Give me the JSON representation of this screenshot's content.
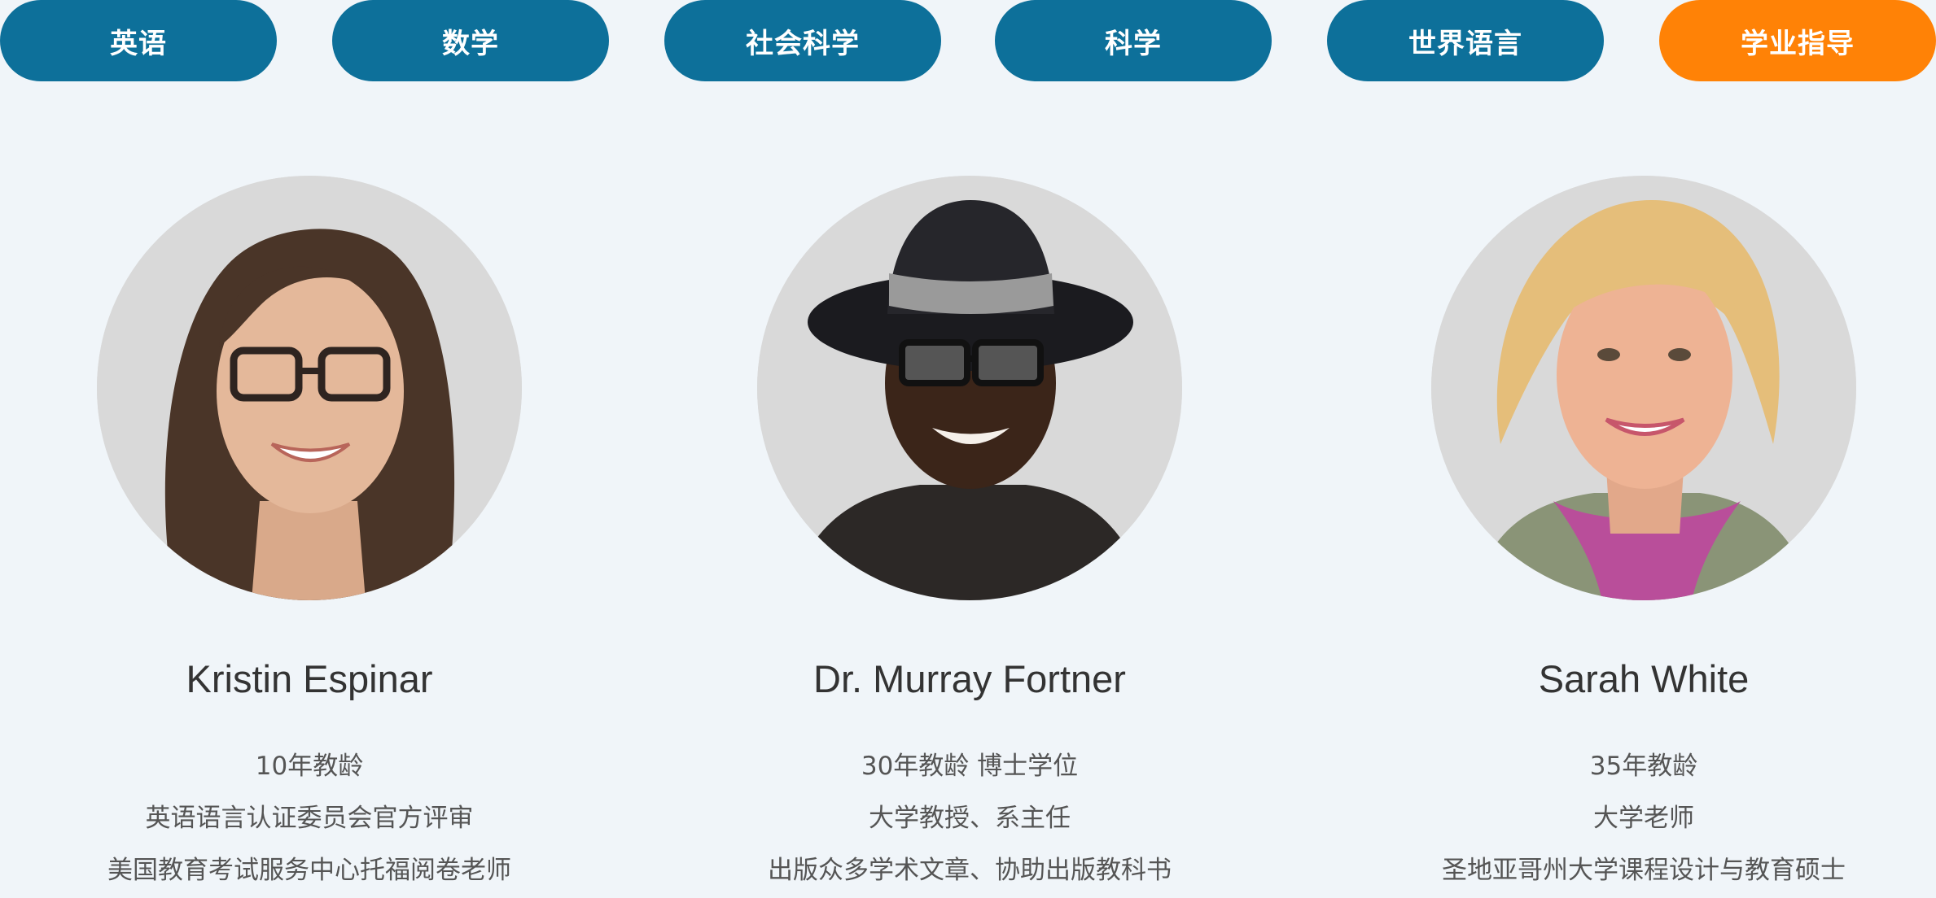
{
  "tabs": [
    {
      "label": "英语"
    },
    {
      "label": "数学"
    },
    {
      "label": "社会科学"
    },
    {
      "label": "科学"
    },
    {
      "label": "世界语言"
    },
    {
      "label": "学业指导",
      "active": true
    }
  ],
  "colors": {
    "tab": "#0d709a",
    "tab_active": "#ff8206",
    "background": "#f0f5f9",
    "avatar_bg": "#d9d9d9"
  },
  "teachers": [
    {
      "name": "Kristin Espinar",
      "photo_icon": "teacher-photo",
      "lines": [
        "10年教龄",
        "英语语言认证委员会官方评审",
        "美国教育考试服务中心托福阅卷老师"
      ]
    },
    {
      "name": "Dr. Murray Fortner",
      "photo_icon": "teacher-photo",
      "lines": [
        "30年教龄 博士学位",
        "大学教授、系主任",
        "出版众多学术文章、协助出版教科书"
      ]
    },
    {
      "name": "Sarah White",
      "photo_icon": "teacher-photo",
      "lines": [
        "35年教龄",
        "大学老师",
        "圣地亚哥州大学课程设计与教育硕士"
      ]
    }
  ]
}
